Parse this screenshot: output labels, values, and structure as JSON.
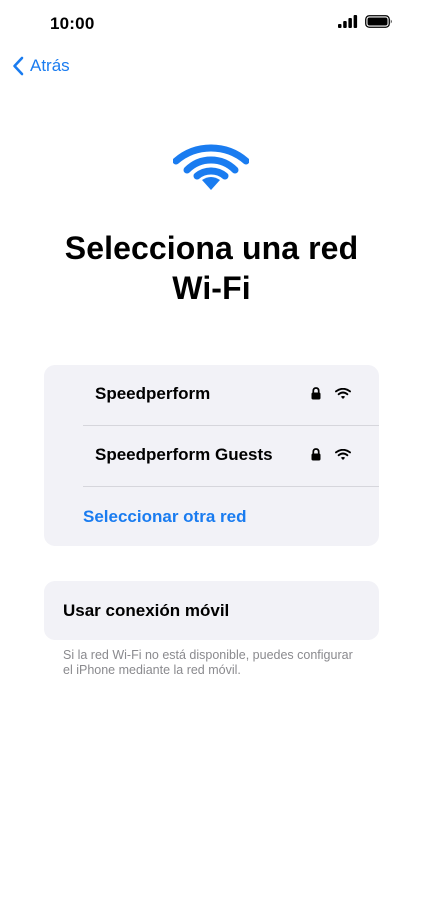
{
  "status_bar": {
    "time": "10:00"
  },
  "nav": {
    "back_label": "Atrás"
  },
  "page": {
    "title_line1": "Selecciona una red",
    "title_line2": "Wi-Fi"
  },
  "networks": [
    {
      "name": "Speedperform",
      "secured": true
    },
    {
      "name": "Speedperform Guests",
      "secured": true
    }
  ],
  "other_network_label": "Seleccionar otra red",
  "cellular": {
    "button_label": "Usar conexión móvil",
    "footnote": "Si la red Wi-Fi no está disponible, puedes configurar el iPhone mediante la red móvil."
  },
  "icons": {
    "signal": "cellular-signal-icon",
    "battery": "battery-icon",
    "back": "chevron-left-icon",
    "wifi": "wifi-icon",
    "lock": "lock-icon"
  },
  "colors": {
    "accent": "#1a7cf0",
    "card_background": "#f2f2f7",
    "secondary_text": "#8a8a8e"
  }
}
